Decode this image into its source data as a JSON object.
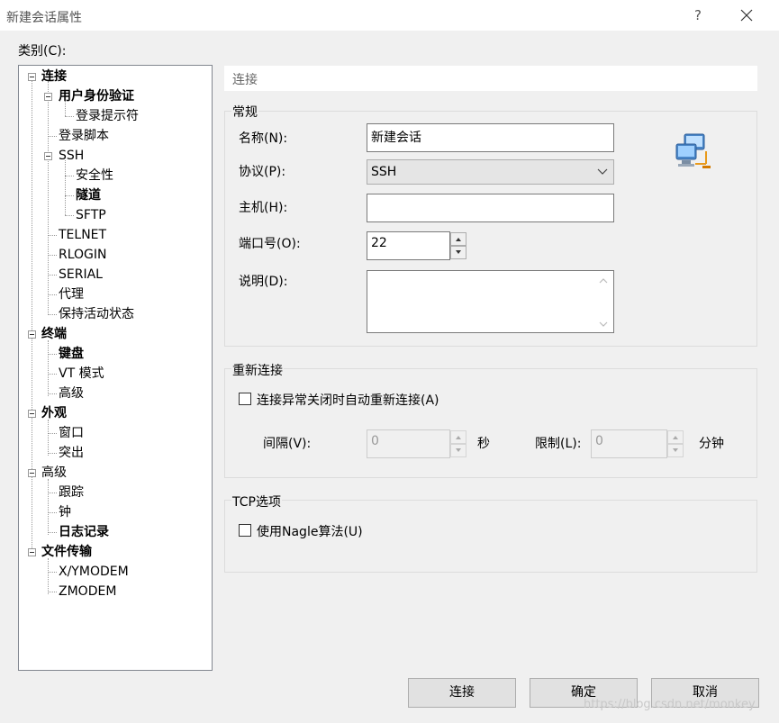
{
  "window": {
    "title": "新建会话属性",
    "help": "?"
  },
  "category_label": "类别(C):",
  "tree": {
    "items": [
      {
        "label": "连接"
      },
      {
        "label": "用户身份验证"
      },
      {
        "label": "登录提示符"
      },
      {
        "label": "登录脚本"
      },
      {
        "label": "SSH"
      },
      {
        "label": "安全性"
      },
      {
        "label": "隧道"
      },
      {
        "label": "SFTP"
      },
      {
        "label": "TELNET"
      },
      {
        "label": "RLOGIN"
      },
      {
        "label": "SERIAL"
      },
      {
        "label": "代理"
      },
      {
        "label": "保持活动状态"
      },
      {
        "label": "终端"
      },
      {
        "label": "键盘"
      },
      {
        "label": "VT 模式"
      },
      {
        "label": "高级"
      },
      {
        "label": "外观"
      },
      {
        "label": "窗口"
      },
      {
        "label": "突出"
      },
      {
        "label": "高级"
      },
      {
        "label": "跟踪"
      },
      {
        "label": "钟"
      },
      {
        "label": "日志记录"
      },
      {
        "label": "文件传输"
      },
      {
        "label": "X/YMODEM"
      },
      {
        "label": "ZMODEM"
      }
    ]
  },
  "panel": {
    "header": "连接",
    "general": {
      "title": "常规",
      "name_label": "名称(N):",
      "name_value": "新建会话",
      "protocol_label": "协议(P):",
      "protocol_value": "SSH",
      "host_label": "主机(H):",
      "host_value": "",
      "port_label": "端口号(O):",
      "port_value": "22",
      "desc_label": "说明(D):",
      "desc_value": ""
    },
    "reconnect": {
      "title": "重新连接",
      "auto_reconnect_label": "连接异常关闭时自动重新连接(A)",
      "auto_reconnect_checked": false,
      "interval_label": "间隔(V):",
      "interval_value": "0",
      "interval_unit": "秒",
      "limit_label": "限制(L):",
      "limit_value": "0",
      "limit_unit": "分钟"
    },
    "tcp": {
      "title": "TCP选项",
      "nagle_label": "使用Nagle算法(U)",
      "nagle_checked": false
    }
  },
  "buttons": {
    "connect": "连接",
    "ok": "确定",
    "cancel": "取消"
  },
  "watermark": "https://blog.csdn.net/monkey"
}
